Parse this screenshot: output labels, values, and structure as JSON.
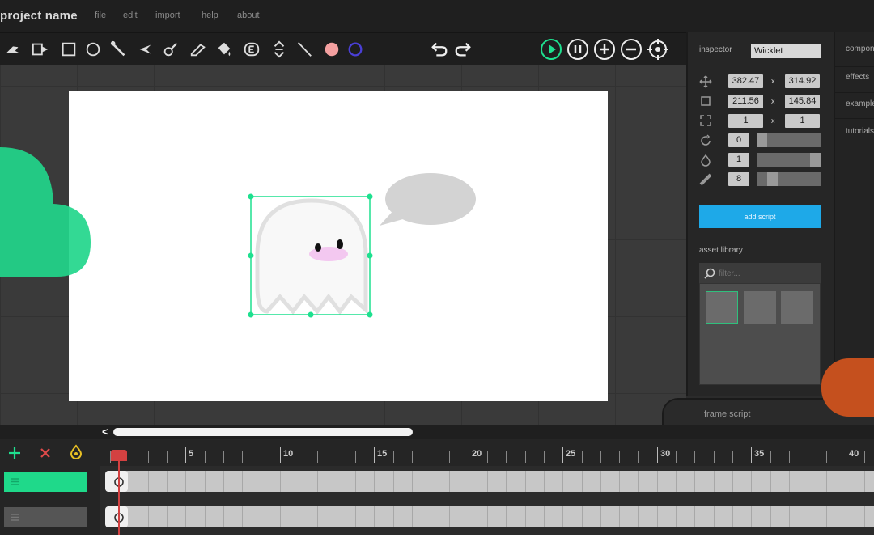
{
  "menubar": {
    "title": "project name",
    "menus": [
      "file",
      "edit",
      "import",
      "help",
      "about"
    ]
  },
  "toolbar": {
    "tools": [
      "pointer-icon",
      "path-select-icon",
      "rectangle-icon",
      "ellipse-icon",
      "brush-icon",
      "pen-icon",
      "eyedropper-icon",
      "pencil-icon",
      "fill-bucket-icon",
      "text-icon",
      "resize-icon",
      "line-icon"
    ],
    "fill_color": "#f4a0a0",
    "stroke_color": "#4a3fd6",
    "playback": [
      "undo-icon",
      "redo-icon",
      "play-icon",
      "pause-icon",
      "zoom-in-icon",
      "zoom-out-icon",
      "recenter-icon"
    ]
  },
  "inspector": {
    "title": "inspector",
    "object_name": "Wicklet",
    "position": {
      "x": "382.47",
      "y": "314.92"
    },
    "size": {
      "w": "211.56",
      "h": "145.84"
    },
    "scale": {
      "x": "1",
      "y": "1"
    },
    "separator": "x",
    "rotation": {
      "value": "0",
      "level": 0
    },
    "opacity": {
      "value": "1",
      "level": 1
    },
    "stroke": {
      "value": "8",
      "level": 0.2
    },
    "add_script": "add script",
    "asset_library": "asset library",
    "filter_placeholder": "filter..."
  },
  "right_tabs": [
    "components",
    "effects",
    "examples",
    "tutorials"
  ],
  "frame_script": "frame script",
  "timeline": {
    "scroll_arrow": "<",
    "ruler_labels": [
      "5",
      "10",
      "15",
      "20",
      "25",
      "30",
      "35",
      "40"
    ],
    "layer_buttons": [
      "add-layer-icon",
      "delete-layer-icon",
      "onion-skin-icon"
    ],
    "layer_accent": "#1fd98a"
  },
  "colors": {
    "accent": "#1ee08f",
    "add_script": "#1ea9e8",
    "playhead": "#d34141"
  }
}
